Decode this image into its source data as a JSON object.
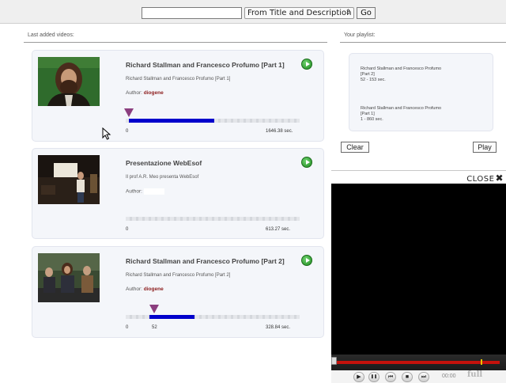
{
  "search": {
    "value": "",
    "select_label": "From Title and Description",
    "go_label": "Go"
  },
  "sections": {
    "videos_label": "Last added videos:",
    "playlist_label": "Your playlist:"
  },
  "videos": [
    {
      "title": "Richard Stallman and Francesco Profumo [Part 1]",
      "description": "Richard Stallman and Francesco Profumo [Part 1]",
      "author_label": "Author:",
      "author": "diogene",
      "start": "0",
      "marker": "",
      "duration": "1646.38 sec.",
      "progress": 0.49
    },
    {
      "title": "Presentazione WebEsof",
      "description": "Il prof A.R. Meo presenta WebEsof",
      "author_label": "Author:",
      "author": "",
      "start": "0",
      "marker": "",
      "duration": "613.27 sec.",
      "progress": 0
    },
    {
      "title": "Richard Stallman and Francesco Profumo [Part 2]",
      "description": "Richard Stallman and Francesco Profumo [Part 2]",
      "author_label": "Author:",
      "author": "diogene",
      "start": "0",
      "marker": "52",
      "duration": "328.84 sec.",
      "progress": 0.26
    }
  ],
  "playlist": {
    "items": [
      {
        "title": "Richard Stallman and Francesco Profumo [Part 2]",
        "range": "52 - 153 sec."
      },
      {
        "title": "Richard Stallman and Francesco Profumo [Part 1]",
        "range": "1 - 860 sec."
      }
    ],
    "clear_label": "Clear",
    "play_label": "Play"
  },
  "player": {
    "close_label": "CLOSE",
    "close_icon": "✖",
    "time": "00:00",
    "full_label": "full",
    "buttons": [
      {
        "name": "play-icon",
        "glyph": "▶"
      },
      {
        "name": "pause-icon",
        "glyph": "❚❚"
      },
      {
        "name": "skip-back-icon",
        "glyph": "⏮"
      },
      {
        "name": "stop-icon",
        "glyph": "■"
      },
      {
        "name": "skip-forward-icon",
        "glyph": "⏭"
      }
    ]
  },
  "colors": {
    "author": "#8b1a1a",
    "progress_fill": "#0000cc",
    "marker": "#8b3e7f",
    "seek_bar": "#c4120c",
    "play_button": "#2a9a2a"
  }
}
